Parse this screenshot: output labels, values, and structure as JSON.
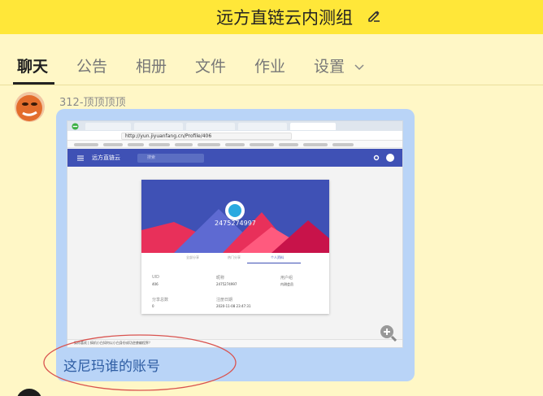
{
  "header": {
    "title": "远方直链云内测组"
  },
  "tabs": [
    {
      "label": "聊天",
      "active": true
    },
    {
      "label": "公告",
      "active": false
    },
    {
      "label": "相册",
      "active": false
    },
    {
      "label": "文件",
      "active": false
    },
    {
      "label": "作业",
      "active": false
    },
    {
      "label": "设置",
      "active": false
    }
  ],
  "message": {
    "sender": "312-顶顶顶顶",
    "caption": "这尼玛谁的账号",
    "screenshot": {
      "url": "http://yun.jiyuanfang.cn/Profile/406",
      "app_title": "远方直链云",
      "search_placeholder": "搜索",
      "uid_display": "2475274997",
      "card_tabs": [
        "全部分享",
        "热门分享",
        "个人资料"
      ],
      "fields": [
        {
          "label": "UID",
          "value": "406"
        },
        {
          "label": "昵称",
          "value": "2475274997"
        },
        {
          "label": "用户组",
          "value": "内测会员"
        },
        {
          "label": "分享总数",
          "value": "0"
        },
        {
          "label": "注册日期",
          "value": "2020-11-08 23:47:31"
        }
      ],
      "status_text": "猜你喜欢 | 搞机小白如何以小白身份成功逆袭编程界？"
    }
  },
  "colors": {
    "header_bg": "#ffe739",
    "page_bg": "#fff7c6",
    "bubble_bg": "#b9d4f7",
    "caption_text": "#2e5da3",
    "app_bar": "#3f51b5",
    "annotation": "#d9534f"
  },
  "icons": {
    "edit": "pencil-icon",
    "settings_dropdown": "chevron-down-icon",
    "zoom": "zoom-in-icon"
  }
}
